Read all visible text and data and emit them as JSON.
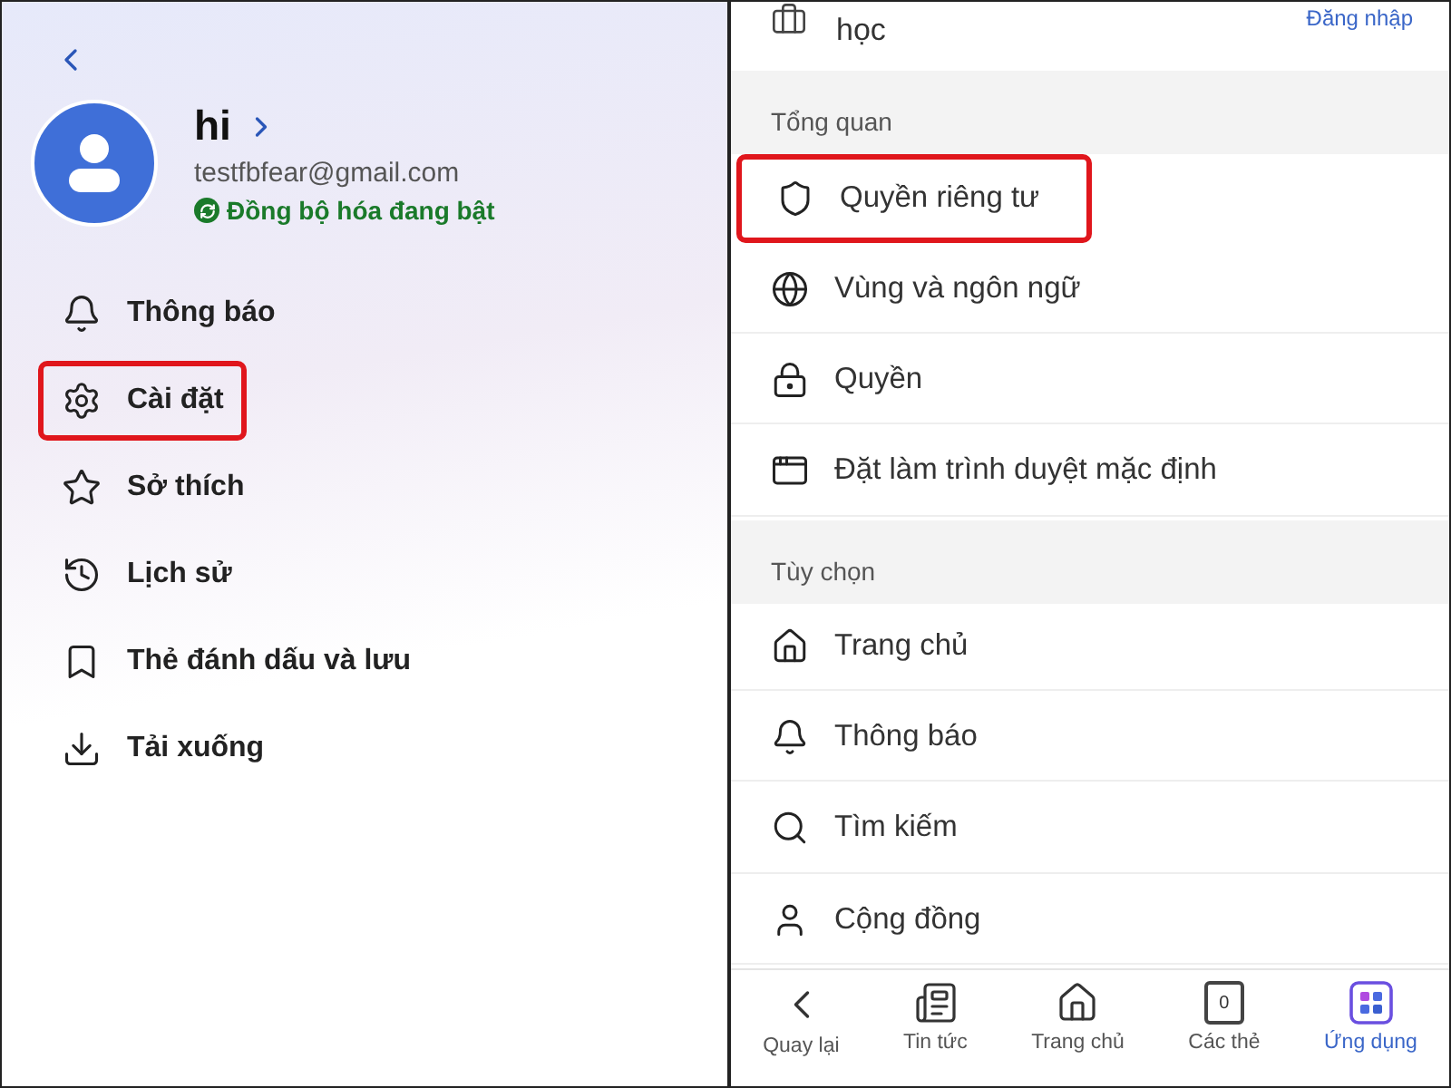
{
  "left": {
    "profile": {
      "name": "hi",
      "email": "testfbfear@gmail.com",
      "sync_status": "Đồng bộ hóa đang bật"
    },
    "menu": [
      {
        "label": "Thông báo",
        "kind": "bell",
        "highlighted": false
      },
      {
        "label": "Cài đặt",
        "kind": "gear",
        "highlighted": true
      },
      {
        "label": "Sở thích",
        "kind": "star",
        "highlighted": false
      },
      {
        "label": "Lịch sử",
        "kind": "history",
        "highlighted": false
      },
      {
        "label": "Thẻ đánh dấu và lưu",
        "kind": "bookmark",
        "highlighted": false
      },
      {
        "label": "Tải xuống",
        "kind": "download",
        "highlighted": false
      }
    ]
  },
  "right": {
    "top_item": {
      "label": "học",
      "action": "Đăng nhập"
    },
    "sections": [
      {
        "title": "Tổng quan",
        "items": [
          {
            "label": "Quyền riêng tư",
            "kind": "shield",
            "highlighted": true
          },
          {
            "label": "Vùng và ngôn ngữ",
            "kind": "globe",
            "highlighted": false
          },
          {
            "label": "Quyền",
            "kind": "lock",
            "highlighted": false
          },
          {
            "label": "Đặt làm trình duyệt mặc định",
            "kind": "browser",
            "highlighted": false
          }
        ]
      },
      {
        "title": "Tùy chọn",
        "items": [
          {
            "label": "Trang chủ",
            "kind": "home",
            "highlighted": false
          },
          {
            "label": "Thông báo",
            "kind": "bell",
            "highlighted": false
          },
          {
            "label": "Tìm kiếm",
            "kind": "search",
            "highlighted": false
          },
          {
            "label": "Cộng đồng",
            "kind": "person",
            "highlighted": false
          }
        ]
      }
    ],
    "nav": [
      {
        "label": "Quay lại",
        "kind": "back",
        "selected": false
      },
      {
        "label": "Tin tức",
        "kind": "news",
        "selected": false
      },
      {
        "label": "Trang chủ",
        "kind": "home",
        "selected": false
      },
      {
        "label": "Các thẻ",
        "kind": "tabs",
        "count": "0",
        "selected": false
      },
      {
        "label": "Ứng dụng",
        "kind": "apps",
        "selected": true
      }
    ]
  }
}
